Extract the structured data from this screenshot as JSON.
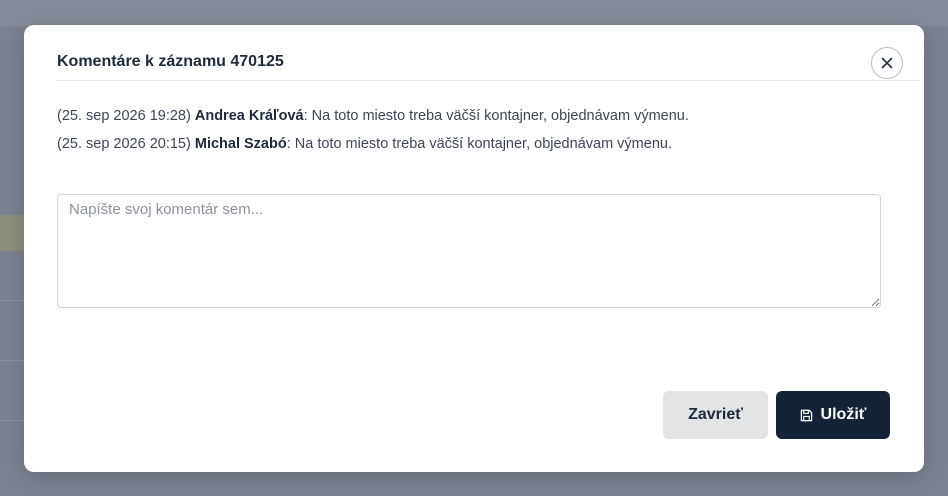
{
  "modal": {
    "title": "Komentáre k záznamu 470125",
    "close_icon": "close-icon"
  },
  "comments": [
    {
      "timestamp": "(25. sep 2026 19:28)",
      "author": "Andrea Kráľová",
      "text": ": Na toto miesto treba väčší kontajner, objednávam výmenu."
    },
    {
      "timestamp": "(25. sep 2026 20:15)",
      "author": "Michal Szabó",
      "text": ": Na toto miesto treba väčší kontajner, objednávam výmenu."
    }
  ],
  "comment_input": {
    "value": "",
    "placeholder": "Napíšte svoj komentár sem..."
  },
  "footer": {
    "close_label": "Zavrieť",
    "save_label": "Uložiť",
    "save_icon": "floppy-disk-icon"
  },
  "colors": {
    "primary": "#142436",
    "secondary_button": "#e3e4e6",
    "overlay": "#7c8290"
  }
}
